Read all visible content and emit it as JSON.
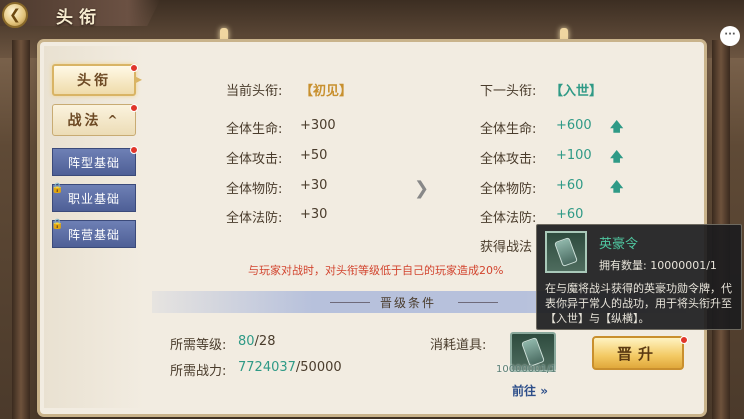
{
  "header": {
    "title": "头衔"
  },
  "sidebar": {
    "tabs": [
      {
        "label": "头衔"
      },
      {
        "label": "战法"
      }
    ],
    "tab2_caret": "^",
    "subtabs": [
      {
        "label": "阵型基础"
      },
      {
        "label": "职业基础"
      },
      {
        "label": "阵营基础"
      }
    ]
  },
  "current": {
    "heading_label": "当前头衔:",
    "heading_value": "【初见】",
    "stats": [
      {
        "label": "全体生命:",
        "value": "+300"
      },
      {
        "label": "全体攻击:",
        "value": "+50"
      },
      {
        "label": "全体物防:",
        "value": "+30"
      },
      {
        "label": "全体法防:",
        "value": "+30"
      }
    ]
  },
  "next": {
    "heading_label": "下一头衔:",
    "heading_value": "【入世】",
    "stats": [
      {
        "label": "全体生命:",
        "value": "+600"
      },
      {
        "label": "全体攻击:",
        "value": "+100"
      },
      {
        "label": "全体物防:",
        "value": "+60"
      },
      {
        "label": "全体法防:",
        "value": "+60"
      }
    ],
    "partial_label": "获得战法"
  },
  "warning": "与玩家对战时，对头衔等级低于自己的玩家造成20%",
  "conditions": {
    "title": "晋级条件",
    "level_label": "所需等级:",
    "level_current": "80",
    "level_required": "/28",
    "power_label": "所需战力:",
    "power_current": "7724037",
    "power_required": "/50000",
    "consume_label": "消耗道具:",
    "item_count": "10000001/1",
    "goto_label": "前往",
    "promote_label": "晋升"
  },
  "tooltip": {
    "name": "英豪令",
    "own_label": "拥有数量:",
    "own_value": "10000001/1",
    "description": "在与魔将战斗获得的英豪功勋令牌，代表你异于常人的战功，用于将头衔升至【入世】与【纵横】。"
  },
  "colors": {
    "accent_green": "#2f9a86",
    "warning_red": "#d2442e",
    "gold": "#c8902e"
  }
}
